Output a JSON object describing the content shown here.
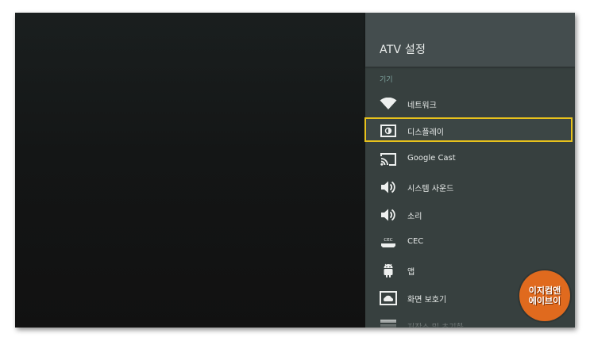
{
  "panel": {
    "title": "ATV 설정",
    "section_label": "기기"
  },
  "menu": {
    "items": [
      {
        "label": "네트워크",
        "icon": "wifi-icon",
        "selected": false
      },
      {
        "label": "디스플레이",
        "icon": "display-icon",
        "selected": true
      },
      {
        "label": "Google Cast",
        "icon": "cast-icon",
        "selected": false
      },
      {
        "label": "시스템 사운드",
        "icon": "speaker-icon",
        "selected": false
      },
      {
        "label": "소리",
        "icon": "speaker-icon",
        "selected": false
      },
      {
        "label": "CEC",
        "icon": "cec-icon",
        "selected": false
      },
      {
        "label": "앱",
        "icon": "android-icon",
        "selected": false
      },
      {
        "label": "화면 보호기",
        "icon": "screensaver-icon",
        "selected": false
      },
      {
        "label": "저장소 및 초기화",
        "icon": "storage-icon",
        "selected": false
      }
    ]
  },
  "watermark": {
    "line1": "이지컴앤",
    "line2": "에이브이"
  },
  "colors": {
    "panel_bg": "#37403f",
    "header_bg": "#444d4e",
    "section_label": "#7fa39e",
    "selection_border": "#e8c21c",
    "watermark_bg": "#e06a1e"
  }
}
